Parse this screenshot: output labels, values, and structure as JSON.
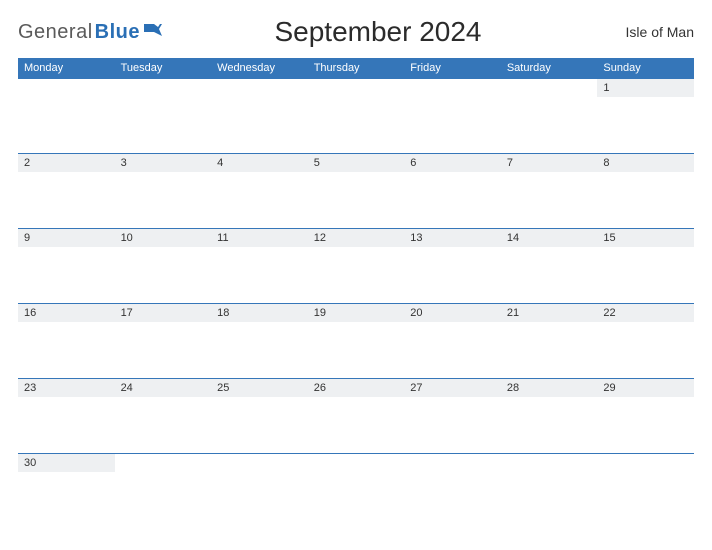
{
  "logo": {
    "part1": "General",
    "part2": "Blue"
  },
  "title": "September 2024",
  "region": "Isle of Man",
  "weekdays": [
    "Monday",
    "Tuesday",
    "Wednesday",
    "Thursday",
    "Friday",
    "Saturday",
    "Sunday"
  ],
  "weeks": [
    [
      "",
      "",
      "",
      "",
      "",
      "",
      "1"
    ],
    [
      "2",
      "3",
      "4",
      "5",
      "6",
      "7",
      "8"
    ],
    [
      "9",
      "10",
      "11",
      "12",
      "13",
      "14",
      "15"
    ],
    [
      "16",
      "17",
      "18",
      "19",
      "20",
      "21",
      "22"
    ],
    [
      "23",
      "24",
      "25",
      "26",
      "27",
      "28",
      "29"
    ],
    [
      "30",
      "",
      "",
      "",
      "",
      "",
      ""
    ]
  ],
  "colors": {
    "accent": "#3576b9"
  }
}
